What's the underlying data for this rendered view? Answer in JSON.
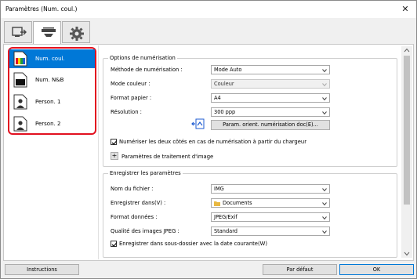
{
  "window": {
    "title": "Paramètres (Num. coul.)",
    "close_glyph": "✕"
  },
  "tabs": [
    {
      "icon": "scan-to-computer-icon"
    },
    {
      "icon": "scanner-icon"
    },
    {
      "icon": "gear-icon"
    }
  ],
  "favorites": [
    {
      "label": "Num. coul.",
      "icon": "color-document-icon"
    },
    {
      "label": "Num. N&B",
      "icon": "bw-document-icon"
    },
    {
      "label": "Person. 1",
      "icon": "person-icon"
    },
    {
      "label": "Person. 2",
      "icon": "person-icon"
    }
  ],
  "scan_options": {
    "title": "Options de numérisation",
    "method_label": "Méthode de numérisation :",
    "method_value": "Mode Auto",
    "color_label": "Mode couleur :",
    "color_value": "Couleur",
    "paper_label": "Format papier :",
    "paper_value": "A4",
    "resolution_label": "Résolution :",
    "resolution_value": "300 ppp",
    "orient_button": "Param. orient. numérisation doc(E)...",
    "duplex_label": "Numériser les deux côtés en cas de numérisation à partir du chargeur",
    "image_processing_label": "Paramètres de traitement d'image",
    "expand_glyph": "+"
  },
  "save_settings": {
    "title": "Enregistrer les paramètres",
    "filename_label": "Nom du fichier :",
    "filename_value": "IMG",
    "savein_label": "Enregistrer dans(V) :",
    "savein_value": "Documents",
    "format_label": "Format données :",
    "format_value": "JPEG/Exif",
    "quality_label": "Qualité des images JPEG :",
    "quality_value": "Standard",
    "subfolder_label": "Enregistrer dans sous-dossier avec la date courante(W)"
  },
  "footer": {
    "instructions": "Instructions",
    "defaults": "Par défaut",
    "ok": "OK"
  },
  "colors": {
    "accent": "#0078d7",
    "highlight": "#e2101f"
  }
}
